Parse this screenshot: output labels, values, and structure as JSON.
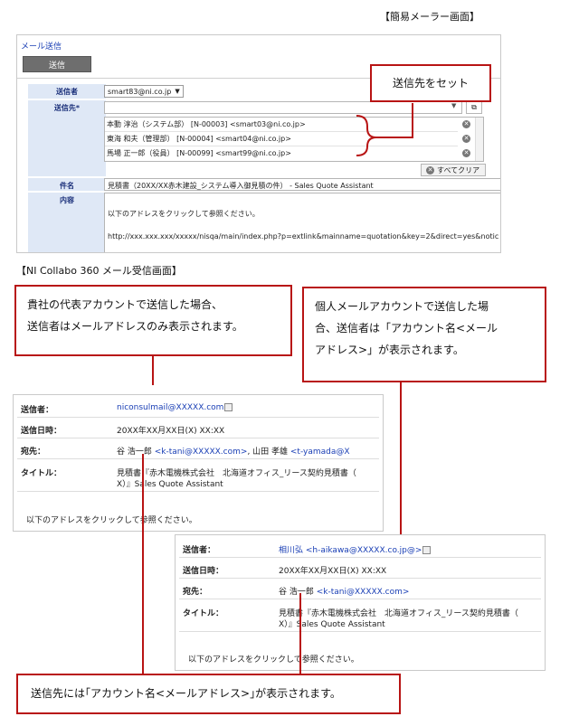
{
  "heading_top": "【簡易メーラー画面】",
  "heading_middle": "【NI Collabo 360 メール受信画面】",
  "mailer": {
    "title": "メール送信",
    "send_button": "送信",
    "sender_label": "送信者",
    "sender_value": "smart83@ni.co.jp",
    "to_label": "送信先*",
    "recipients": [
      "本動 淳治（システム部） [N-00003] <smart03@ni.co.jp>",
      "東海 和夫（管理部） [N-00004] <smart04@ni.co.jp>",
      "馬場 正一郎（役員） [N-00099] <smart99@ni.co.jp>"
    ],
    "clear_all": "すべてクリア",
    "subject_label": "件名",
    "subject_value": "見積書（20XX/XX赤木建設_システム導入御見積の件） - Sales Quote Assistant",
    "content_label": "内容",
    "body_line1": "以下のアドレスをクリックして参照ください。",
    "body_line2": "http://xxx.xxx.xxx/xxxxx/nisqa/main/index.php?p=extlink&mainname=quotation&key=2&direct=yes&notic"
  },
  "callouts": {
    "set_recipient": "送信先をセット",
    "company_line1": "貴社の代表アカウントで送信した場合、",
    "company_line2": "送信者はメールアドレスのみ表示されます。",
    "personal_line1": "個人メールアカウントで送信した場",
    "personal_line2": "合、送信者は「アカウント名<メール",
    "personal_line3": "アドレス>」が表示されます。",
    "bottom": "送信先には｢アカウント名<メールアドレス>｣が表示されます。"
  },
  "receive1": {
    "sender_label": "送信者：",
    "sender_value": "niconsulmail@XXXXX.com",
    "date_label": "送信日時：",
    "date_value": "20XX年XX月XX日(X) XX:XX",
    "to_label": "宛先：",
    "to_name1": "谷 浩一郎 ",
    "to_addr1": "<k-tani@XXXXX.com>",
    "to_sep": ", 山田 孝雄 ",
    "to_addr2": "<t-yamada@X",
    "title_label": "タイトル：",
    "title_line1": "見積書『赤木電機株式会社　北海道オフィス_リース契約見積書（",
    "title_line2": "X）』Sales Quote Assistant",
    "body": "以下のアドレスをクリックして参照ください。"
  },
  "receive2": {
    "sender_label": "送信者：",
    "sender_value": "相川弘 <h-aikawa@XXXXX.co.jp@>",
    "date_label": "送信日時：",
    "date_value": "20XX年XX月XX日(X) XX:XX",
    "to_label": "宛先：",
    "to_name1": "谷 浩一郎 ",
    "to_addr1": "<k-tani@XXXXX.com>",
    "title_label": "タイトル：",
    "title_line1": "見積書『赤木電機株式会社　北海道オフィス_リース契約見積書（",
    "title_line2": "X）』Sales Quote Assistant",
    "body": "以下のアドレスをクリックして参照ください。"
  }
}
